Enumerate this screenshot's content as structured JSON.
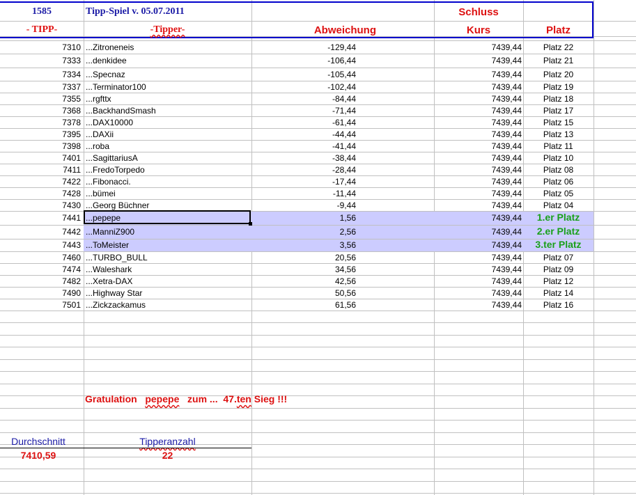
{
  "header": {
    "count": "1585",
    "title": "Tipp-Spiel v. 05.07.2011",
    "schluss": "Schluss",
    "col_tipp": "- TIPP-",
    "col_tipper": "-Tipper-",
    "col_abweichung": "Abweichung",
    "col_kurs": "Kurs",
    "col_platz": "Platz"
  },
  "rows": [
    {
      "tipp": "7310",
      "tipper": "...Zitroneneis",
      "abw": "-129,44",
      "kurs": "7439,44",
      "platz": "Platz 22"
    },
    {
      "tipp": "7333",
      "tipper": "...denkidee",
      "abw": "-106,44",
      "kurs": "7439,44",
      "platz": "Platz 21"
    },
    {
      "tipp": "7334",
      "tipper": "...Specnaz",
      "abw": "-105,44",
      "kurs": "7439,44",
      "platz": "Platz 20"
    },
    {
      "tipp": "7337",
      "tipper": "...Terminator100",
      "abw": "-102,44",
      "kurs": "7439,44",
      "platz": "Platz 19"
    },
    {
      "tipp": "7355",
      "tipper": "...rgfttx",
      "abw": "-84,44",
      "kurs": "7439,44",
      "platz": "Platz 18"
    },
    {
      "tipp": "7368",
      "tipper": "...BackhandSmash",
      "abw": "-71,44",
      "kurs": "7439,44",
      "platz": "Platz 17"
    },
    {
      "tipp": "7378",
      "tipper": "...DAX10000",
      "abw": "-61,44",
      "kurs": "7439,44",
      "platz": "Platz 15"
    },
    {
      "tipp": "7395",
      "tipper": "...DAXii",
      "abw": "-44,44",
      "kurs": "7439,44",
      "platz": "Platz 13"
    },
    {
      "tipp": "7398",
      "tipper": "...roba",
      "abw": "-41,44",
      "kurs": "7439,44",
      "platz": "Platz 11"
    },
    {
      "tipp": "7401",
      "tipper": "...SagittariusA",
      "abw": "-38,44",
      "kurs": "7439,44",
      "platz": "Platz 10"
    },
    {
      "tipp": "7411",
      "tipper": "...FredoTorpedo",
      "abw": "-28,44",
      "kurs": "7439,44",
      "platz": "Platz 08"
    },
    {
      "tipp": "7422",
      "tipper": "...Fibonacci.",
      "abw": "-17,44",
      "kurs": "7439,44",
      "platz": "Platz 06"
    },
    {
      "tipp": "7428",
      "tipper": "...bümei",
      "abw": "-11,44",
      "kurs": "7439,44",
      "platz": "Platz 05"
    },
    {
      "tipp": "7430",
      "tipper": "...Georg  Büchner",
      "abw": "-9,44",
      "kurs": "7439,44",
      "platz": "Platz 04"
    },
    {
      "tipp": "7441",
      "tipper": "...pepepe",
      "abw": "1,56",
      "kurs": "7439,44",
      "platz": "1.er Platz",
      "top": true
    },
    {
      "tipp": "7442",
      "tipper": "...ManniZ900",
      "abw": "2,56",
      "kurs": "7439,44",
      "platz": "2.er Platz",
      "top": true
    },
    {
      "tipp": "7443",
      "tipper": "...ToMeister",
      "abw": "3,56",
      "kurs": "7439,44",
      "platz": "3.ter Platz",
      "top": true
    },
    {
      "tipp": "7460",
      "tipper": "...TURBO_BULL",
      "abw": "20,56",
      "kurs": "7439,44",
      "platz": "Platz 07"
    },
    {
      "tipp": "7474",
      "tipper": "...Waleshark",
      "abw": "34,56",
      "kurs": "7439,44",
      "platz": "Platz 09"
    },
    {
      "tipp": "7482",
      "tipper": "...Xetra-DAX",
      "abw": "42,56",
      "kurs": "7439,44",
      "platz": "Platz 12"
    },
    {
      "tipp": "7490",
      "tipper": "...Highway Star",
      "abw": "50,56",
      "kurs": "7439,44",
      "platz": "Platz 14"
    },
    {
      "tipp": "7501",
      "tipper": "...Zickzackamus",
      "abw": "61,56",
      "kurs": "7439,44",
      "platz": "Platz 16"
    }
  ],
  "footer": {
    "gratulation": "Gratulation",
    "winner": "pepepe",
    "zum": "zum  ...",
    "sieg_num": "47.",
    "sieg_ten": "ten",
    "sieg": "Sieg !!!",
    "avg_label": "Durchschnitt",
    "avg_value": "7410,59",
    "count_label": "Tipperanzahl",
    "count_value": "22"
  },
  "colors": {
    "highlight": "#ccccff",
    "header_border": "#0000cc",
    "accent_red": "#dd1111",
    "podium_green": "#1aa01a"
  }
}
